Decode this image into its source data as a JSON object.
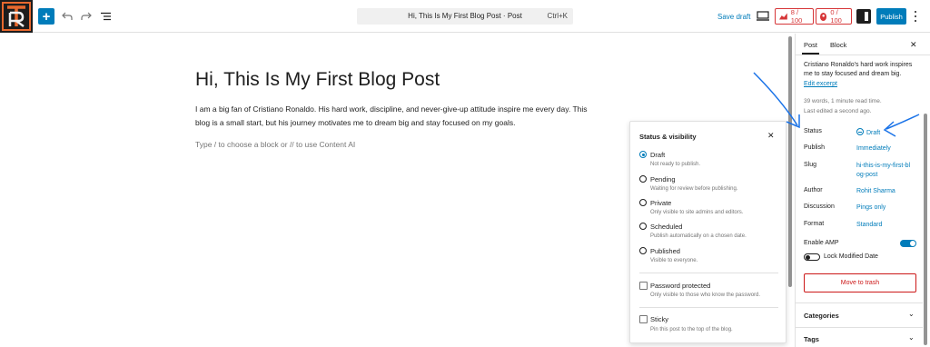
{
  "topbar": {
    "logo_letters": "TR",
    "add_block_icon": "plus-icon",
    "undo_icon": "undo-icon",
    "redo_icon": "redo-icon",
    "outline_icon": "list-view-icon",
    "command_title": "Hi, This Is My First Blog Post · Post",
    "command_shortcut": "Ctrl+K",
    "save_draft": "Save draft",
    "preview_icon": "desktop-preview-icon",
    "seo_score": "8 / 100",
    "readability_score": "0 / 100",
    "settings_icon": "sidebar-toggle-icon",
    "publish": "Publish",
    "options_icon": "kebab-menu-icon"
  },
  "editor": {
    "title": "Hi, This Is My First Blog Post",
    "body": "I am a big fan of Cristiano Ronaldo. His hard work, discipline, and never-give-up attitude inspire me every day. This blog is a small start, but his journey motivates me to dream big and stay focused on my goals.",
    "placeholder": "Type / to choose a block or // to use Content AI"
  },
  "status_popover": {
    "title": "Status & visibility",
    "options": [
      {
        "label": "Draft",
        "desc": "Not ready to publish.",
        "selected": true
      },
      {
        "label": "Pending",
        "desc": "Waiting for review before publishing.",
        "selected": false
      },
      {
        "label": "Private",
        "desc": "Only visible to site admins and editors.",
        "selected": false
      },
      {
        "label": "Scheduled",
        "desc": "Publish automatically on a chosen date.",
        "selected": false
      },
      {
        "label": "Published",
        "desc": "Visible to everyone.",
        "selected": false
      }
    ],
    "password": {
      "label": "Password protected",
      "desc": "Only visible to those who know the password."
    },
    "sticky": {
      "label": "Sticky",
      "desc": "Pin this post to the top of the blog."
    }
  },
  "sidebar": {
    "tabs": [
      "Post",
      "Block"
    ],
    "excerpt": "Cristiano Ronaldo's hard work inspires me to stay focused and dream big.",
    "edit_excerpt": "Edit excerpt",
    "word_count": "39 words, 1 minute read time.",
    "last_edited": "Last edited a second ago.",
    "rows": {
      "status": {
        "label": "Status",
        "value": "Draft"
      },
      "publish": {
        "label": "Publish",
        "value": "Immediately"
      },
      "slug": {
        "label": "Slug",
        "value": "hi-this-is-my-first-blog-post"
      },
      "author": {
        "label": "Author",
        "value": "Rohit Sharma"
      },
      "discussion": {
        "label": "Discussion",
        "value": "Pings only"
      },
      "format": {
        "label": "Format",
        "value": "Standard"
      }
    },
    "enable_amp": {
      "label": "Enable AMP",
      "on": true
    },
    "lock_modified": {
      "label": "Lock Modified Date",
      "on": false
    },
    "trash": "Move to trash",
    "panels": [
      "Categories",
      "Tags"
    ]
  },
  "colors": {
    "accent": "#007cba",
    "danger": "#cc1818",
    "annotation": "#1a73e8"
  }
}
